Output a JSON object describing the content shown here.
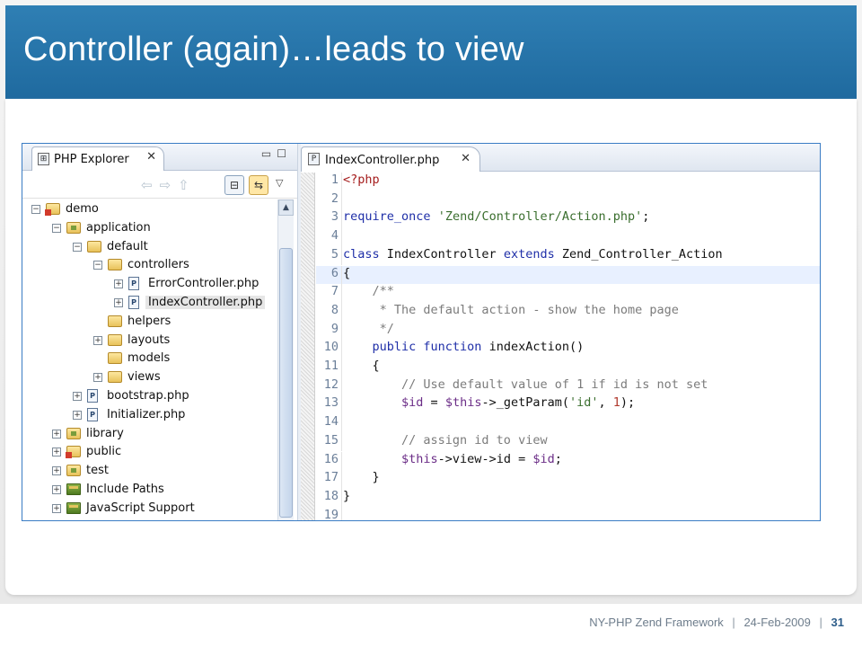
{
  "slide": {
    "title": "Controller (again)…leads to view",
    "footer": {
      "text": "NY-PHP Zend Framework",
      "date": "24-Feb-2009",
      "separator": "|",
      "page": "31"
    }
  },
  "explorer": {
    "tab_label": "PHP Explorer",
    "tab_close": "✕",
    "tree": [
      {
        "label": "demo",
        "depth": 0,
        "expander": "−",
        "icon": "project-icon"
      },
      {
        "label": "application",
        "depth": 1,
        "expander": "−",
        "icon": "package-folder-icon"
      },
      {
        "label": "default",
        "depth": 2,
        "expander": "−",
        "icon": "folder-icon"
      },
      {
        "label": "controllers",
        "depth": 3,
        "expander": "−",
        "icon": "folder-icon"
      },
      {
        "label": "ErrorController.php",
        "depth": 4,
        "expander": "+",
        "icon": "php-file-icon"
      },
      {
        "label": "IndexController.php",
        "depth": 4,
        "expander": "+",
        "icon": "php-file-icon",
        "selected": true
      },
      {
        "label": "helpers",
        "depth": 3,
        "expander": "",
        "icon": "folder-icon"
      },
      {
        "label": "layouts",
        "depth": 3,
        "expander": "+",
        "icon": "folder-icon"
      },
      {
        "label": "models",
        "depth": 3,
        "expander": "",
        "icon": "folder-icon"
      },
      {
        "label": "views",
        "depth": 3,
        "expander": "+",
        "icon": "folder-icon"
      },
      {
        "label": "bootstrap.php",
        "depth": 2,
        "expander": "+",
        "icon": "php-file-icon"
      },
      {
        "label": "Initializer.php",
        "depth": 2,
        "expander": "+",
        "icon": "php-file-icon"
      },
      {
        "label": "library",
        "depth": 1,
        "expander": "+",
        "icon": "package-folder-icon"
      },
      {
        "label": "public",
        "depth": 1,
        "expander": "+",
        "icon": "project-icon"
      },
      {
        "label": "test",
        "depth": 1,
        "expander": "+",
        "icon": "package-folder-icon"
      },
      {
        "label": "Include Paths",
        "depth": 1,
        "expander": "+",
        "icon": "library-icon"
      },
      {
        "label": "JavaScript Support",
        "depth": 1,
        "expander": "+",
        "icon": "library-icon"
      }
    ]
  },
  "editor": {
    "tab_label": "IndexController.php",
    "tab_close": "✕",
    "current_line": 6,
    "lines": [
      {
        "n": "1",
        "parts": [
          [
            "php-tag",
            "<?php"
          ]
        ]
      },
      {
        "n": "2",
        "parts": []
      },
      {
        "n": "3",
        "parts": [
          [
            "kw",
            "require_once"
          ],
          [
            "plain",
            " "
          ],
          [
            "str",
            "'Zend/Controller/Action.php'"
          ],
          [
            "plain",
            ";"
          ]
        ]
      },
      {
        "n": "4",
        "parts": []
      },
      {
        "n": "5",
        "parts": [
          [
            "kw",
            "class"
          ],
          [
            "plain",
            " IndexController "
          ],
          [
            "kw",
            "extends"
          ],
          [
            "plain",
            " Zend_Controller_Action"
          ]
        ]
      },
      {
        "n": "6",
        "parts": [
          [
            "plain",
            "{"
          ]
        ]
      },
      {
        "n": "7",
        "parts": [
          [
            "dc",
            "    /**"
          ]
        ]
      },
      {
        "n": "8",
        "parts": [
          [
            "dc",
            "     * The default action - show the home page"
          ]
        ]
      },
      {
        "n": "9",
        "parts": [
          [
            "dc",
            "     */"
          ]
        ]
      },
      {
        "n": "10",
        "parts": [
          [
            "plain",
            "    "
          ],
          [
            "kw",
            "public function"
          ],
          [
            "plain",
            " indexAction()"
          ]
        ]
      },
      {
        "n": "11",
        "parts": [
          [
            "plain",
            "    {"
          ]
        ]
      },
      {
        "n": "12",
        "parts": [
          [
            "cm",
            "        // Use default value of 1 if id is not set"
          ]
        ]
      },
      {
        "n": "13",
        "parts": [
          [
            "plain",
            "        "
          ],
          [
            "var",
            "$id"
          ],
          [
            "plain",
            " = "
          ],
          [
            "var",
            "$this"
          ],
          [
            "plain",
            "->_getParam("
          ],
          [
            "str",
            "'id'"
          ],
          [
            "plain",
            ", "
          ],
          [
            "num",
            "1"
          ],
          [
            "plain",
            ");"
          ]
        ]
      },
      {
        "n": "14",
        "parts": []
      },
      {
        "n": "15",
        "parts": [
          [
            "cm",
            "        // assign id to view"
          ]
        ]
      },
      {
        "n": "16",
        "parts": [
          [
            "plain",
            "        "
          ],
          [
            "var",
            "$this"
          ],
          [
            "plain",
            "->view->id = "
          ],
          [
            "var",
            "$id"
          ],
          [
            "plain",
            ";"
          ]
        ]
      },
      {
        "n": "17",
        "parts": [
          [
            "plain",
            "    }"
          ]
        ]
      },
      {
        "n": "18",
        "parts": [
          [
            "plain",
            "}"
          ]
        ]
      },
      {
        "n": "19",
        "parts": []
      }
    ]
  }
}
